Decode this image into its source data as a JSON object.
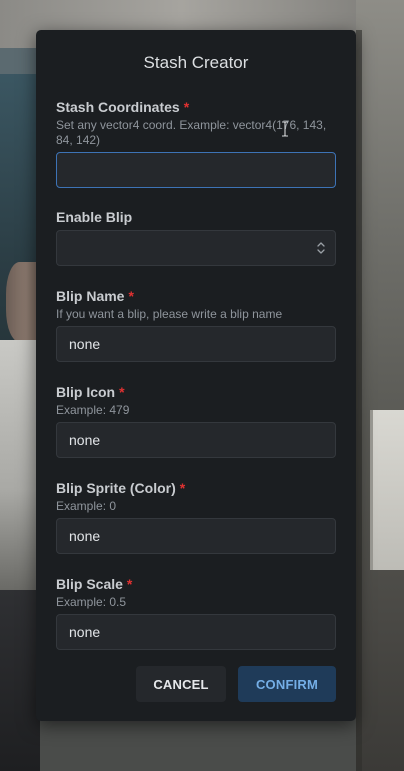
{
  "modal": {
    "title": "Stash Creator",
    "required_marker": "*"
  },
  "fields": {
    "stash_coordinates": {
      "label": "Stash Coordinates",
      "description": "Set any vector4 coord. Example: vector4(176, 143, 84, 142)",
      "value": ""
    },
    "enable_blip": {
      "label": "Enable Blip",
      "selected": ""
    },
    "blip_name": {
      "label": "Blip Name",
      "description": "If you want a blip, please write a blip name",
      "value": "none"
    },
    "blip_icon": {
      "label": "Blip Icon",
      "description": "Example: 479",
      "value": "none"
    },
    "blip_sprite": {
      "label": "Blip Sprite (Color)",
      "description": "Example: 0",
      "value": "none"
    },
    "blip_scale": {
      "label": "Blip Scale",
      "description": "Example: 0.5",
      "value": "none"
    }
  },
  "buttons": {
    "cancel": "CANCEL",
    "confirm": "CONFIRM"
  },
  "icons": {
    "select_chevron": "chevron-up-down-icon",
    "text_cursor": "text-cursor-icon"
  },
  "colors": {
    "modal_bg": "#1b1e21",
    "input_bg": "#25282c",
    "focus_border": "#3d73b6",
    "required": "#e03131",
    "confirm_bg": "#1f3b59",
    "confirm_text": "#74aee6"
  }
}
